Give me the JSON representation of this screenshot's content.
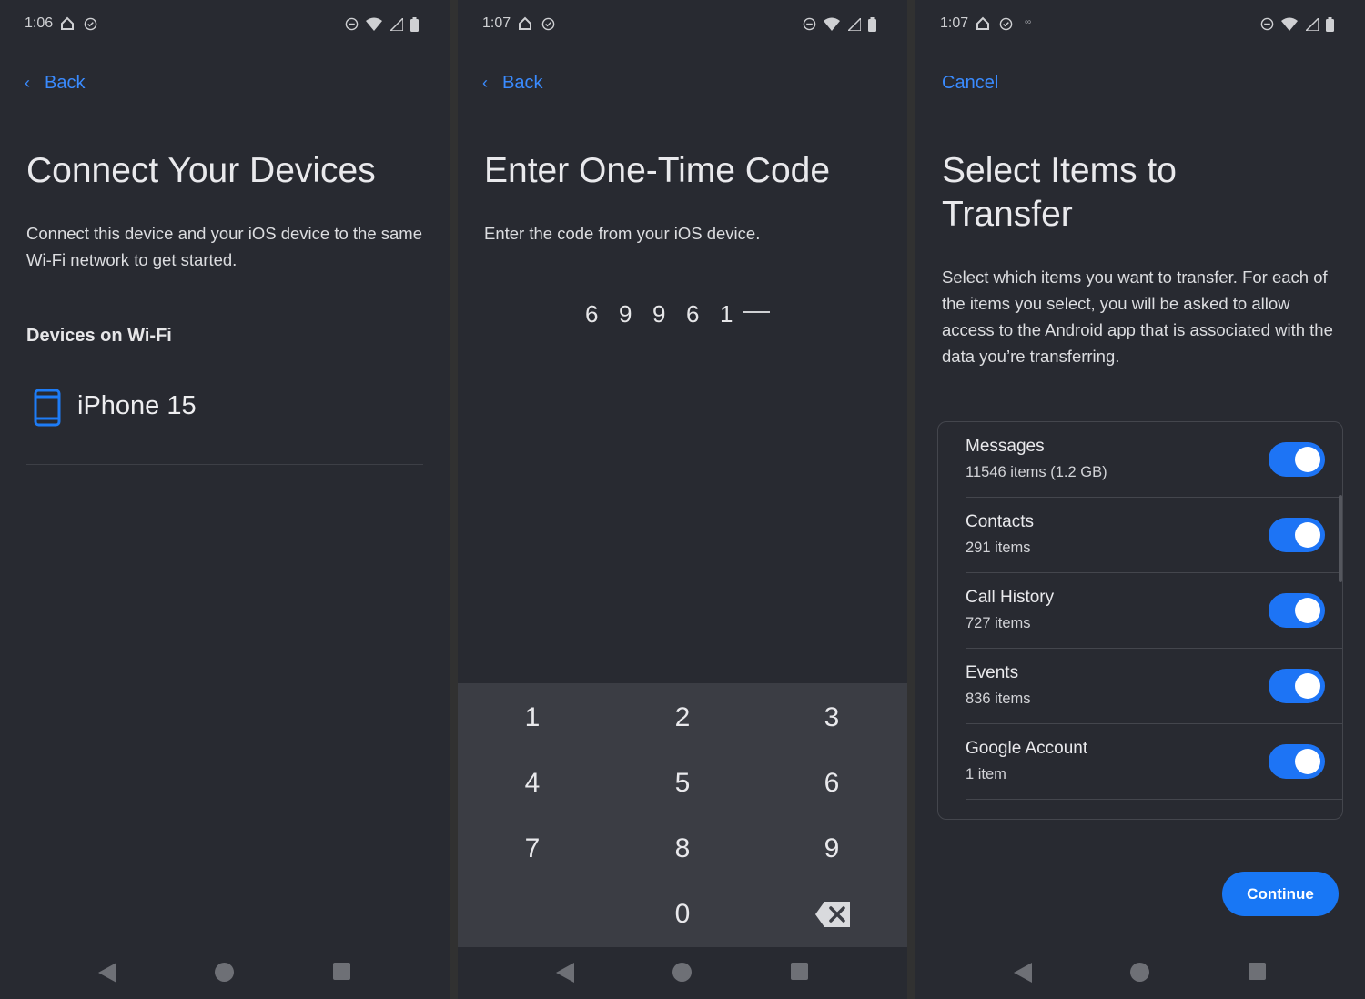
{
  "colors": {
    "accent": "#1877f5",
    "link": "#3a8bff",
    "background": "#282a31",
    "keypad": "#3b3d44"
  },
  "screen1": {
    "status_time": "1:06",
    "back_label": "Back",
    "title": "Connect Your Devices",
    "description": "Connect this device and your iOS device to the same Wi-Fi network to get started.",
    "section_heading": "Devices on Wi-Fi",
    "device": {
      "icon": "phone-icon",
      "name": "iPhone 15"
    }
  },
  "screen2": {
    "status_time": "1:07",
    "back_label": "Back",
    "title": "Enter One-Time Code",
    "description": "Enter the code from your iOS device.",
    "code_digits": [
      "6",
      "9",
      "9",
      "6",
      "1"
    ],
    "keypad": [
      "1",
      "2",
      "3",
      "4",
      "5",
      "6",
      "7",
      "8",
      "9",
      "0"
    ]
  },
  "screen3": {
    "status_time": "1:07",
    "status_extra": "∞",
    "cancel_label": "Cancel",
    "title": "Select Items to Transfer",
    "description": "Select which items you want to transfer. For each of the items you select, you will be asked to allow access to the Android app that is associated with the data you’re transferring.",
    "items": [
      {
        "name": "Messages",
        "count": "11546 items (1.2 GB)",
        "enabled": true
      },
      {
        "name": "Contacts",
        "count": "291 items",
        "enabled": true
      },
      {
        "name": "Call History",
        "count": "727 items",
        "enabled": true
      },
      {
        "name": "Events",
        "count": "836 items",
        "enabled": true
      },
      {
        "name": "Google Account",
        "count": "1 item",
        "enabled": true
      }
    ],
    "continue_label": "Continue"
  }
}
